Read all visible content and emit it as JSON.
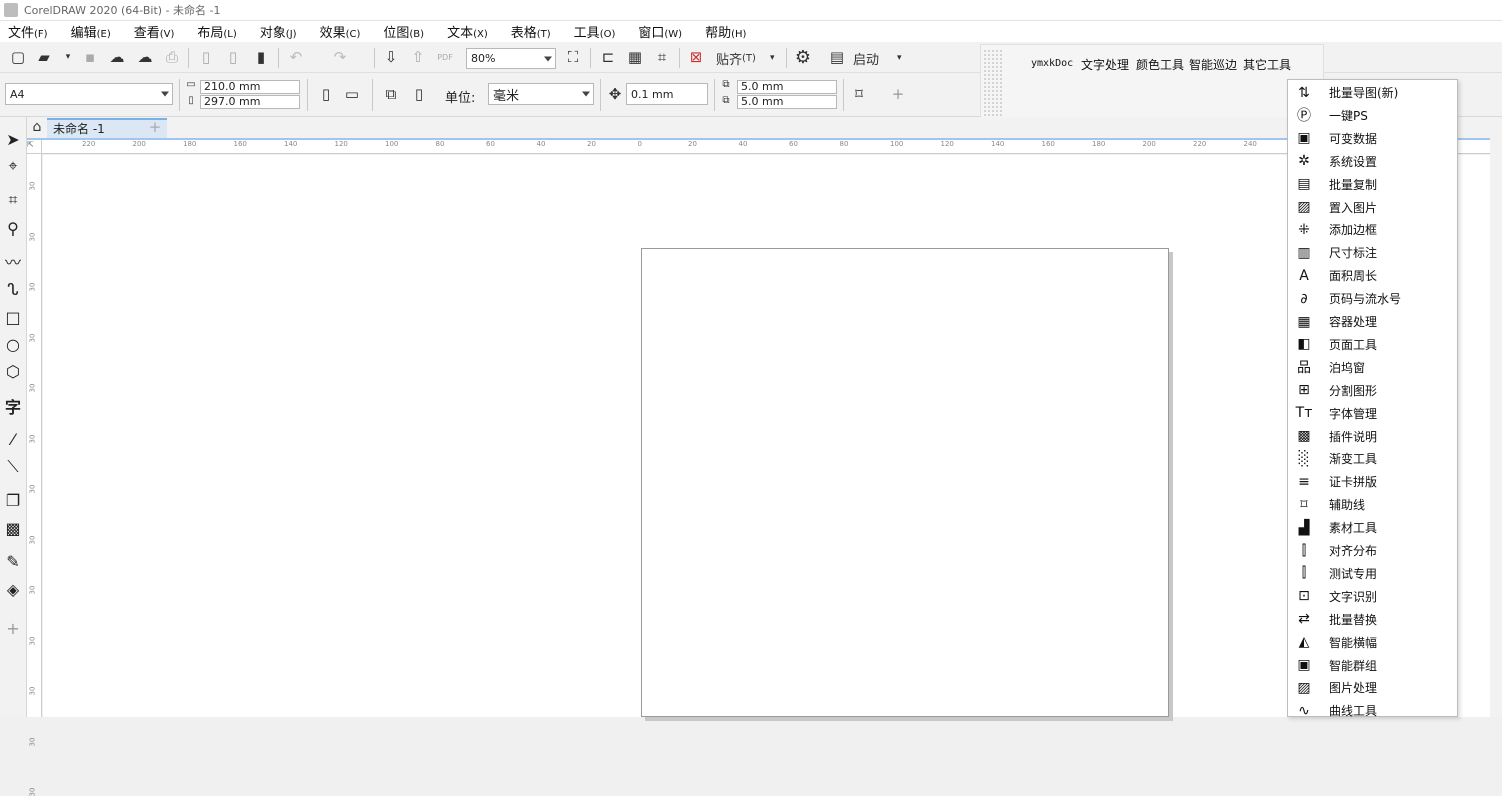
{
  "window": {
    "title": "CorelDRAW 2020 (64-Bit) - 未命名 -1"
  },
  "menu": [
    {
      "label": "文件",
      "key": "(F)"
    },
    {
      "label": "编辑",
      "key": "(E)"
    },
    {
      "label": "查看",
      "key": "(V)"
    },
    {
      "label": "布局",
      "key": "(L)"
    },
    {
      "label": "对象",
      "key": "(J)"
    },
    {
      "label": "效果",
      "key": "(C)"
    },
    {
      "label": "位图",
      "key": "(B)"
    },
    {
      "label": "文本",
      "key": "(X)"
    },
    {
      "label": "表格",
      "key": "(T)"
    },
    {
      "label": "工具",
      "key": "(O)"
    },
    {
      "label": "窗口",
      "key": "(W)"
    },
    {
      "label": "帮助",
      "key": "(H)"
    }
  ],
  "toolbar": {
    "zoom": "80%",
    "snap_label": "贴齐",
    "snap_key": "(T)",
    "launch_label": "启动"
  },
  "property_bar": {
    "page_size": "A4",
    "width": "210.0 mm",
    "height": "297.0 mm",
    "unit_label": "单位:",
    "unit_value": "毫米",
    "nudge": "0.1 mm",
    "dup_x": "5.0 mm",
    "dup_y": "5.0 mm"
  },
  "plugin_menu": [
    "ymxkDoc",
    "文字处理",
    "颜色工具",
    "智能巡边",
    "其它工具"
  ],
  "document_tab": "未命名 -1",
  "ruler": {
    "h_ticks": [
      "220",
      "200",
      "180",
      "160",
      "140",
      "120",
      "100",
      "80",
      "60",
      "40",
      "20",
      "0",
      "20",
      "40",
      "60",
      "80",
      "100",
      "120",
      "140",
      "160",
      "180",
      "200",
      "220",
      "240",
      "340"
    ],
    "v_ticks": [
      "30",
      "30",
      "30",
      "30",
      "30",
      "30",
      "30",
      "30",
      "30",
      "30",
      "30",
      "30",
      "30"
    ]
  },
  "dropdown": [
    {
      "icon": "batch-export-icon",
      "glyph": "⇅",
      "label": "批量导图(新)"
    },
    {
      "icon": "ps-icon",
      "glyph": "Ⓟ",
      "label": "一键PS"
    },
    {
      "icon": "variable-data-icon",
      "glyph": "▣",
      "label": "可变数据"
    },
    {
      "icon": "settings-icon",
      "glyph": "✲",
      "label": "系统设置"
    },
    {
      "icon": "batch-copy-icon",
      "glyph": "▤",
      "label": "批量复制"
    },
    {
      "icon": "place-image-icon",
      "glyph": "▨",
      "label": "置入图片"
    },
    {
      "icon": "add-border-icon",
      "glyph": "⁜",
      "label": "添加边框"
    },
    {
      "icon": "dimension-icon",
      "glyph": "▥",
      "label": "尺寸标注"
    },
    {
      "icon": "area-perimeter-icon",
      "glyph": "A",
      "label": "面积周长"
    },
    {
      "icon": "page-number-icon",
      "glyph": "∂",
      "label": "页码与流水号"
    },
    {
      "icon": "container-icon",
      "glyph": "▦",
      "label": "容器处理"
    },
    {
      "icon": "page-tools-icon",
      "glyph": "◧",
      "label": "页面工具"
    },
    {
      "icon": "docker-icon",
      "glyph": "品",
      "label": "泊坞窗"
    },
    {
      "icon": "split-shape-icon",
      "glyph": "⊞",
      "label": "分割图形"
    },
    {
      "icon": "font-manager-icon",
      "glyph": "Tт",
      "label": "字体管理"
    },
    {
      "icon": "plugin-info-icon",
      "glyph": "▩",
      "label": "插件说明"
    },
    {
      "icon": "gradient-icon",
      "glyph": "░",
      "label": "渐变工具"
    },
    {
      "icon": "id-card-icon",
      "glyph": "≡",
      "label": "证卡拼版"
    },
    {
      "icon": "guideline-icon",
      "glyph": "⌑",
      "label": "辅助线"
    },
    {
      "icon": "material-icon",
      "glyph": "▟",
      "label": "素材工具"
    },
    {
      "icon": "align-icon",
      "glyph": "⫿",
      "label": "对齐分布"
    },
    {
      "icon": "test-icon",
      "glyph": "⫿",
      "label": "测试专用"
    },
    {
      "icon": "ocr-icon",
      "glyph": "⊡",
      "label": "文字识别"
    },
    {
      "icon": "batch-replace-icon",
      "glyph": "⇄",
      "label": "批量替换"
    },
    {
      "icon": "smart-banner-icon",
      "glyph": "◭",
      "label": "智能横幅"
    },
    {
      "icon": "smart-group-icon",
      "glyph": "▣",
      "label": "智能群组"
    },
    {
      "icon": "image-process-icon",
      "glyph": "▨",
      "label": "图片处理"
    },
    {
      "icon": "curve-tools-icon",
      "glyph": "∿",
      "label": "曲线工具"
    }
  ]
}
